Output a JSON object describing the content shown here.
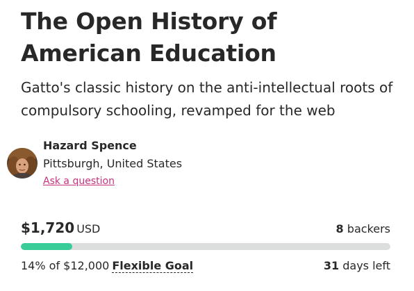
{
  "campaign": {
    "title": "The Open History of American Education",
    "blurb": "Gatto's classic history on the anti-intellectual roots of compulsory schooling, revamped for the web"
  },
  "creator": {
    "name": "Hazard Spence",
    "location": "Pittsburgh, United States",
    "ask_label": "Ask a question",
    "avatar_icon": "profile-photo"
  },
  "funding": {
    "amount": "$1,720",
    "currency": "USD",
    "backers_count": "8",
    "backers_label": "backers",
    "percent_funded": 14,
    "percent_text": "14% of $12,000",
    "goal_type": "Flexible Goal",
    "days_left_count": "31",
    "days_left_label": "days left"
  },
  "colors": {
    "accent_link": "#c6327f",
    "progress_fill": "#37cc98",
    "progress_track": "#dcdedd",
    "text": "#282828"
  }
}
